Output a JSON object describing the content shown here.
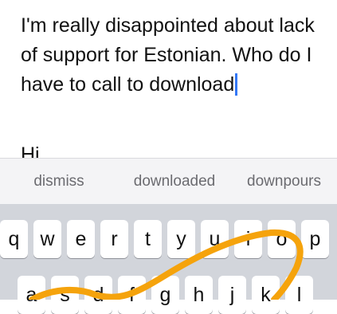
{
  "message": {
    "lines": [
      "I'm really disappointed about lack",
      "of support for Estonian. Who do I",
      "have to call to download"
    ],
    "cut_off_line": "Hi"
  },
  "suggestions": [
    "dismiss",
    "downloaded",
    "downpours"
  ],
  "keyboard": {
    "row1": [
      "q",
      "w",
      "e",
      "r",
      "t",
      "y",
      "u",
      "i",
      "o",
      "p"
    ],
    "row2": [
      "a",
      "s",
      "d",
      "f",
      "g",
      "h",
      "j",
      "k",
      "l"
    ]
  },
  "colors": {
    "swipe_trail": "#f5a30c",
    "caret": "#3478f6",
    "keyboard_background": "#d2d5db"
  }
}
